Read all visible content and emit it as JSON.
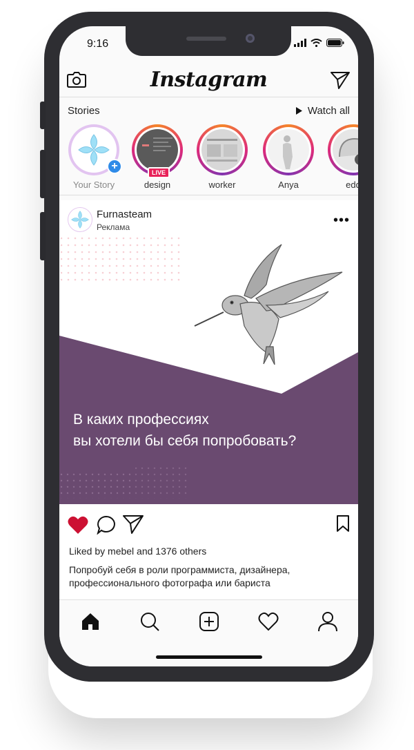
{
  "status": {
    "time": "9:16"
  },
  "header": {
    "app_title": "Instagram"
  },
  "stories": {
    "heading": "Stories",
    "watch_all": "Watch all",
    "items": [
      {
        "label": "Your Story",
        "badge": "+"
      },
      {
        "label": "design",
        "badge": "LIVE"
      },
      {
        "label": "worker"
      },
      {
        "label": "Anya"
      },
      {
        "label": "edd"
      }
    ]
  },
  "post": {
    "author": "Furnasteam",
    "subtitle": "Реклама",
    "image_text_line1": "В каких профессиях",
    "image_text_line2": "вы хотели бы себя попробовать?",
    "liked_by": "Liked by mebel and 1376 others",
    "caption": "Попробуй себя в роли программиста, дизайнера, профессионального фотографа или бариста"
  },
  "colors": {
    "banner_purple": "#6a4a70",
    "like_red": "#cc1133",
    "live_pink": "#e8235a",
    "add_blue": "#2f8be8"
  },
  "icons": [
    "camera-icon",
    "direct-send-icon",
    "play-icon",
    "heart-icon",
    "comment-icon",
    "share-icon",
    "bookmark-icon",
    "home-icon",
    "search-icon",
    "add-post-icon",
    "activity-icon",
    "profile-icon"
  ]
}
